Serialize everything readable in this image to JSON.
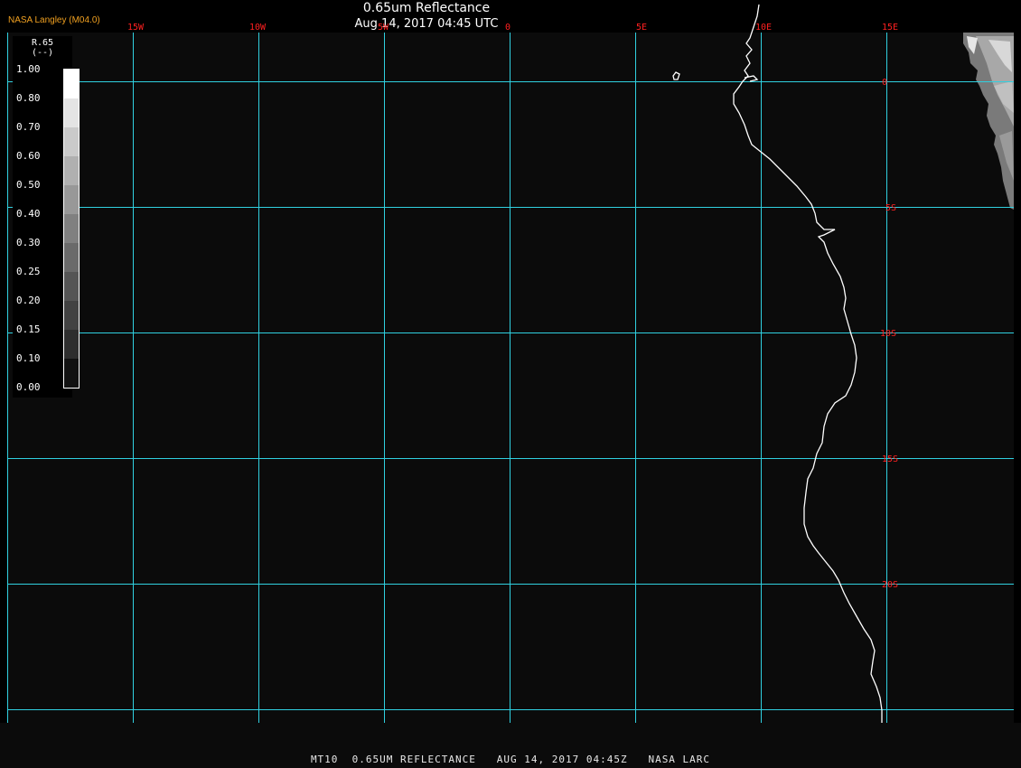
{
  "header": {
    "title": "0.65um Reflectance",
    "datetime": "Aug 14, 2017 04:45 UTC",
    "source": "NASA Langley (M04.0)"
  },
  "footer": {
    "text": "MT10  0.65UM REFLECTANCE   AUG 14, 2017 04:45Z   NASA LARC"
  },
  "map": {
    "longitude_labels": [
      "15W",
      "10W",
      "5W",
      "0",
      "5E",
      "10E",
      "15E"
    ],
    "latitude_labels": [
      "0",
      "5S",
      "10S",
      "15S",
      "20S"
    ],
    "grid_color": "#30d0e0",
    "label_color": "#ff2020",
    "coast_color": "#ffffff"
  },
  "legend": {
    "variable": "R.65",
    "units": "(--)",
    "ticks": [
      "1.00",
      "0.80",
      "0.70",
      "0.60",
      "0.50",
      "0.40",
      "0.30",
      "0.25",
      "0.20",
      "0.15",
      "0.10",
      "0.00"
    ]
  }
}
